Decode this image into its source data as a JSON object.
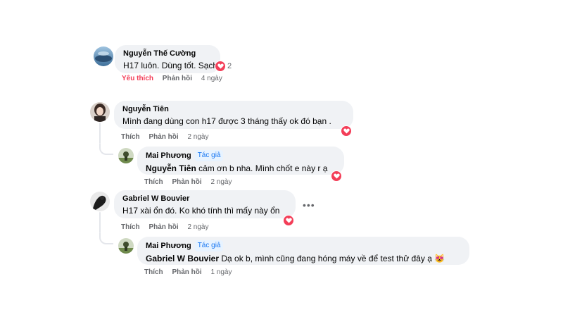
{
  "comments": [
    {
      "author": "Nguyễn Thế Cường",
      "text": "H17 luôn. Dùng tốt. Sạch",
      "like": "Yêu thích",
      "reply": "Phản hồi",
      "time": "4 ngày",
      "reaction_count": "2"
    },
    {
      "author": "Nguyễn Tiên",
      "text": "Mình đang dùng con h17 được 3 tháng thấy ok đó bạn .",
      "like": "Thích",
      "reply": "Phản hồi",
      "time": "2 ngày"
    },
    {
      "author": "Mai Phương",
      "badge": "Tác giả",
      "mention": "Nguyễn Tiên",
      "text": " cảm ơn b nha. Mình chốt e này r ạ",
      "like": "Thích",
      "reply": "Phản hồi",
      "time": "2 ngày"
    },
    {
      "author": "Gabriel W Bouvier",
      "text": "H17 xài ổn đó. Ko khó tính thì mấy này ổn",
      "like": "Thích",
      "reply": "Phản hồi",
      "time": "2 ngày",
      "more": "•••"
    },
    {
      "author": "Mai Phương",
      "badge": "Tác giả",
      "mention": "Gabriel W Bouvier",
      "text": " Dạ ok b, mình cũng đang hóng máy về để test thử đây ạ 😻",
      "like": "Thích",
      "reply": "Phản hồi",
      "time": "1 ngày"
    }
  ],
  "icons": {
    "reaction": "heart-icon",
    "more": "more-options-icon"
  },
  "colors": {
    "bubble": "#f0f2f5",
    "love": "#f33e58",
    "badge": "#1877f2",
    "meta": "#65676b"
  }
}
